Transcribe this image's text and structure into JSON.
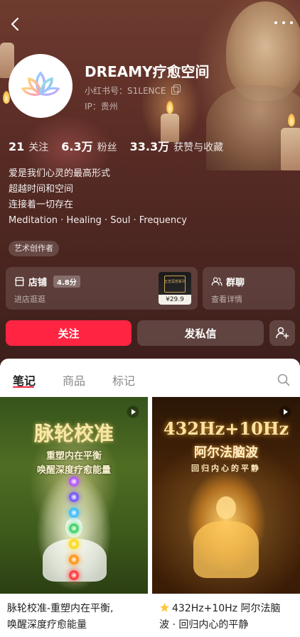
{
  "header": {
    "display_name": "DREAMY疗愈空间",
    "account_id": "小红书号：S1LENCE",
    "ip_location": "IP：贵州"
  },
  "stats": {
    "following": {
      "value": "21",
      "label": "关注"
    },
    "followers": {
      "value": "6.3万",
      "label": "粉丝"
    },
    "likes": {
      "value": "33.3万",
      "label": "获赞与收藏"
    }
  },
  "bio": {
    "lines": [
      "爱是我们心灵的最高形式",
      "超越时间和空间",
      "连接着一切存在",
      "Meditation · Healing · Soul · Frequency"
    ]
  },
  "tag": "艺术创作者",
  "shop": {
    "title": "店铺",
    "rating": "4.8分",
    "subtitle": "进店逛逛",
    "product_price": "¥29.9",
    "product_text": "正念冥想系列"
  },
  "group_chat": {
    "title": "群聊",
    "subtitle": "查看详情"
  },
  "actions": {
    "follow": "关注",
    "message": "发私信"
  },
  "tabs": [
    "笔记",
    "商品",
    "标记"
  ],
  "active_tab": "笔记",
  "notes": [
    {
      "cover_title": "脉轮校准",
      "cover_subtitle_1": "重塑内在平衡",
      "cover_subtitle_2": "唤醒深度疗愈能量",
      "caption_line_1": "脉轮校准-重塑内在平衡,",
      "caption_line_2": "唤醒深度疗愈能量",
      "chakra_colors": [
        "#b04cff",
        "#6a4bff",
        "#2fb8ff",
        "#2fcf5c",
        "#ffd400",
        "#ff8a00",
        "#ff2a2a"
      ]
    },
    {
      "cover_title": "432Hz+10Hz",
      "cover_subtitle_1": "阿尔法脑波",
      "cover_subtitle_2": "回归内心的平静",
      "caption_line_1": "432Hz+10Hz 阿尔法脑",
      "caption_line_2": "波 · 回归内心的平静"
    }
  ],
  "colors": {
    "accent": "#ff2442",
    "header_bg": "#5b2d26"
  }
}
